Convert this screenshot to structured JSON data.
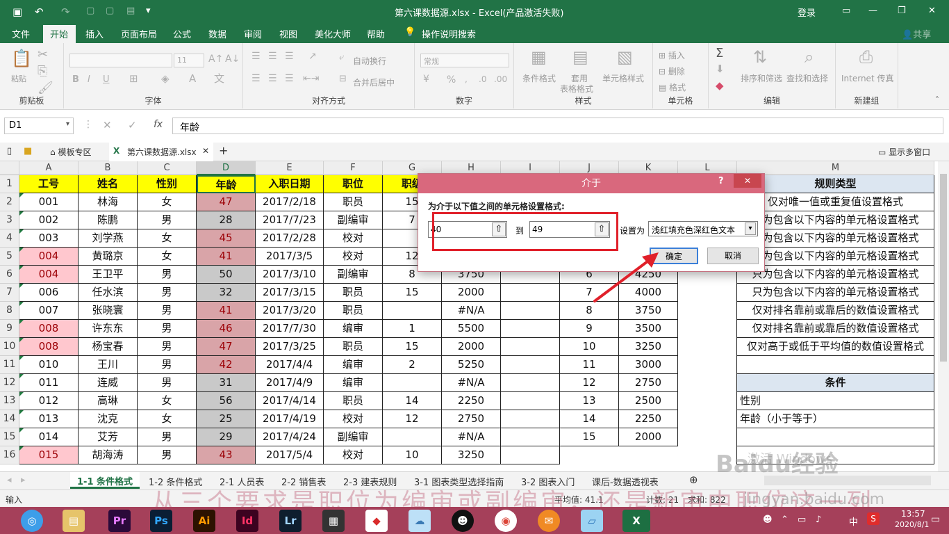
{
  "titlebar": {
    "file": "第六课数据源.xlsx",
    "separator": "-",
    "app": "Excel(产品激活失败)",
    "login": "登录"
  },
  "ribbon_tabs": [
    "文件",
    "开始",
    "插入",
    "页面布局",
    "公式",
    "数据",
    "审阅",
    "视图",
    "美化大师",
    "帮助",
    "操作说明搜索"
  ],
  "share": "共享",
  "ribbon": {
    "clipboard": {
      "label": "剪贴板",
      "paste": "粘贴"
    },
    "font": {
      "label": "字体",
      "size": "11",
      "bold": "B",
      "italic": "I",
      "underline": "U"
    },
    "align": {
      "label": "对齐方式",
      "wrap": "自动换行",
      "merge": "合并后居中"
    },
    "number": {
      "label": "数字",
      "format": "常规",
      "pct": "%"
    },
    "styles": {
      "label": "样式",
      "cond": "条件格式",
      "table_l1": "套用",
      "table_l2": "表格格式",
      "cell": "单元格样式"
    },
    "cells": {
      "label": "单元格",
      "insert": "插入",
      "delete": "删除",
      "format": "格式"
    },
    "editing": {
      "label": "编辑",
      "sort": "排序和筛选",
      "find": "查找和选择"
    },
    "new": {
      "label": "新建组",
      "internet": "Internet 传真"
    }
  },
  "formula": {
    "namebox": "D1",
    "content": "年龄",
    "fx": "fx"
  },
  "doctabs": {
    "template": "模板专区",
    "file": "第六课数据源.xlsx",
    "multi": "显示多窗口"
  },
  "columns": [
    "A",
    "B",
    "C",
    "D",
    "E",
    "F",
    "G",
    "H",
    "I",
    "J",
    "K",
    "L",
    "M"
  ],
  "rows": [
    "1",
    "2",
    "3",
    "4",
    "5",
    "6",
    "7",
    "8",
    "9",
    "10",
    "11",
    "12",
    "13",
    "14",
    "15",
    "16"
  ],
  "table": {
    "headers": [
      "工号",
      "姓名",
      "性别",
      "年龄",
      "入职日期",
      "职位",
      "职级"
    ],
    "data": [
      [
        "001",
        "林海",
        "女",
        "47",
        "2017/2/18",
        "职员",
        "15"
      ],
      [
        "002",
        "陈鹏",
        "男",
        "28",
        "2017/7/23",
        "副编审",
        "7"
      ],
      [
        "003",
        "刘学燕",
        "女",
        "45",
        "2017/2/28",
        "校对",
        ""
      ],
      [
        "004",
        "黄璐京",
        "女",
        "41",
        "2017/3/5",
        "校对",
        "12"
      ],
      [
        "004",
        "王卫平",
        "男",
        "50",
        "2017/3/10",
        "副编审",
        "8"
      ],
      [
        "006",
        "任水滨",
        "男",
        "32",
        "2017/3/15",
        "职员",
        "15"
      ],
      [
        "007",
        "张晓寰",
        "男",
        "41",
        "2017/3/20",
        "职员",
        ""
      ],
      [
        "008",
        "许东东",
        "男",
        "46",
        "2017/7/30",
        "编审",
        "1"
      ],
      [
        "008",
        "杨宝春",
        "男",
        "47",
        "2017/3/25",
        "职员",
        "15"
      ],
      [
        "010",
        "王川",
        "男",
        "42",
        "2017/4/4",
        "编审",
        "2"
      ],
      [
        "011",
        "连威",
        "男",
        "31",
        "2017/4/9",
        "编审",
        ""
      ],
      [
        "012",
        "高琳",
        "女",
        "56",
        "2017/4/14",
        "职员",
        "14"
      ],
      [
        "013",
        "沈克",
        "女",
        "25",
        "2017/4/19",
        "校对",
        "12"
      ],
      [
        "014",
        "艾芳",
        "男",
        "29",
        "2017/4/24",
        "副编审",
        ""
      ],
      [
        "015",
        "胡海涛",
        "男",
        "43",
        "2017/5/4",
        "校对",
        "10"
      ]
    ]
  },
  "h_col": [
    "3750",
    "2000",
    "#N/A",
    "5500",
    "2000",
    "5250",
    "#N/A",
    "2250",
    "2750",
    "#N/A",
    "3250"
  ],
  "jk_rows": [
    [
      "6",
      "4250"
    ],
    [
      "7",
      "4000"
    ],
    [
      "8",
      "3750"
    ],
    [
      "9",
      "3500"
    ],
    [
      "10",
      "3250"
    ],
    [
      "11",
      "3000"
    ],
    [
      "12",
      "2750"
    ],
    [
      "13",
      "2500"
    ],
    [
      "14",
      "2250"
    ],
    [
      "15",
      "2000"
    ]
  ],
  "m_col": {
    "header": "规则类型",
    "items": [
      "仅对唯一值或重复值设置格式",
      "只为包含以下内容的单元格设置格式",
      "只为包含以下内容的单元格设置格式",
      "只为包含以下内容的单元格设置格式",
      "只为包含以下内容的单元格设置格式",
      "只为包含以下内容的单元格设置格式",
      "仅对排名靠前或靠后的数值设置格式",
      "仅对排名靠前或靠后的数值设置格式",
      "仅对高于或低于平均值的数值设置格式"
    ],
    "cond_header": "条件",
    "cond_items": [
      "性别",
      "年龄（小于等于）"
    ]
  },
  "sheet_tabs": [
    "1-1 条件格式",
    "1-2 条件格式",
    "2-1 人员表",
    "2-2 销售表",
    "2-3 建表规则",
    "3-1 图表类型选择指南",
    "3-2 图表入门",
    "课后-数据透视表"
  ],
  "status": {
    "mode": "输入",
    "avg": "平均值: 41.1",
    "count": "计数: 21",
    "sum": "求和: 822"
  },
  "clock": {
    "time": "13:57",
    "date": "2020/8/1"
  },
  "taskbar": {
    "ime": "中"
  },
  "dialog": {
    "title": "介于",
    "help": "?",
    "close": "✕",
    "prompt": "为介于以下值之间的单元格设置格式:",
    "from": "40",
    "to_label": "到",
    "to": "49",
    "set_as": "设置为",
    "format": "浅红填充色深红色文本",
    "ok": "确定",
    "cancel": "取消"
  },
  "watermark": {
    "text": "从三个要求是职位为编审或副编审，还是新审中职位这一列",
    "baidu": "Baidu经验",
    "url": "jingyan.baidu.com",
    "activate": "激活 Windows"
  },
  "colors": {
    "excel_green": "#217346",
    "highlight_red": "#e0202a",
    "taskbar": "#a5405a"
  }
}
